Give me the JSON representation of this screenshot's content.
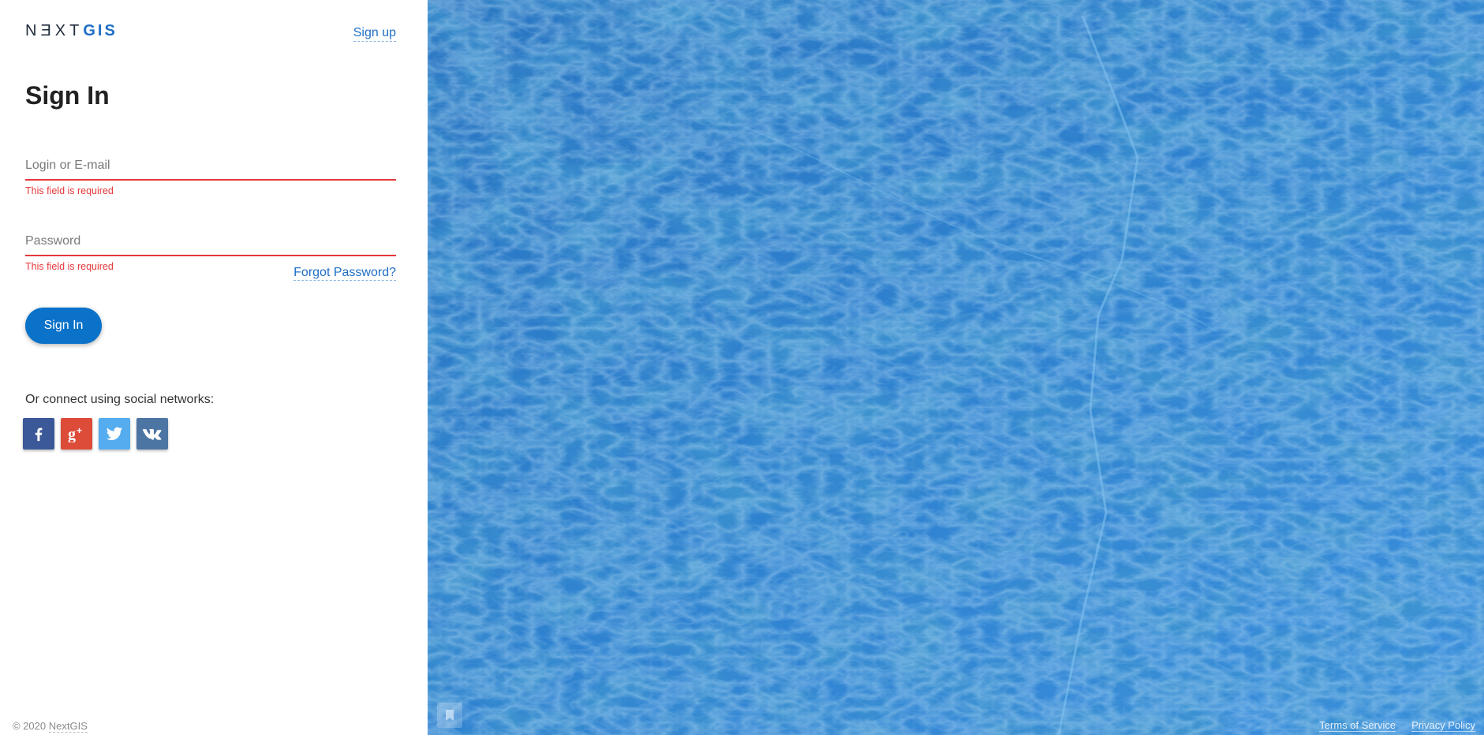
{
  "brand": {
    "logo_next": "NƎXT",
    "logo_gis": "GIS",
    "accent": "#1f6fc5"
  },
  "header": {
    "signup_label": "Sign up"
  },
  "form": {
    "title": "Sign In",
    "login_placeholder": "Login or E-mail",
    "login_value": "",
    "login_error": "This field is required",
    "password_placeholder": "Password",
    "password_value": "",
    "password_error": "This field is required",
    "forgot_label": "Forgot Password?",
    "submit_label": "Sign In",
    "error_color": "#e5383b"
  },
  "social": {
    "label": "Or connect using social networks:",
    "networks": [
      {
        "name": "facebook",
        "icon": "facebook-icon",
        "color": "#3b5998"
      },
      {
        "name": "google-plus",
        "icon": "google-plus-icon",
        "color": "#dd4b39"
      },
      {
        "name": "twitter",
        "icon": "twitter-icon",
        "color": "#55acee"
      },
      {
        "name": "vk",
        "icon": "vk-icon",
        "color": "#4c75a3"
      }
    ]
  },
  "footer": {
    "copyright_prefix": "© 2020",
    "copyright_company": "NextGIS",
    "terms_label": "Terms of Service",
    "privacy_label": "Privacy Policy"
  },
  "background": {
    "overlay_color": "#2f7fce"
  }
}
